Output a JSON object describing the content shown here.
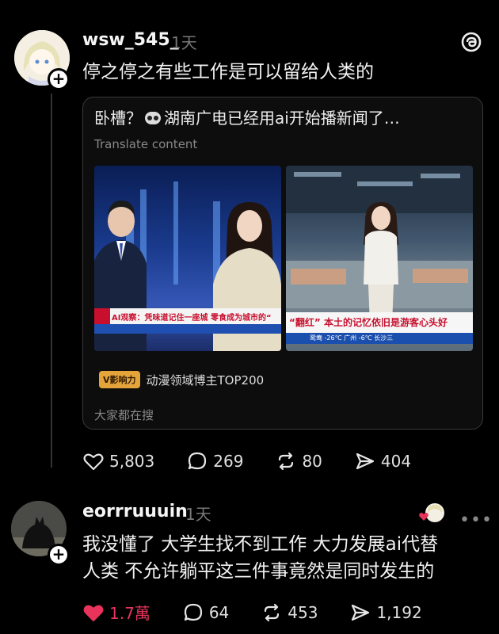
{
  "post": {
    "username": "wsw_545_",
    "time": "1天",
    "text": "停之停之有些工作是可以留给人类的",
    "card": {
      "title_prefix": "卧槽？",
      "title_suffix": "湖南广电已经用ai开始播新闻了…",
      "translate": "Translate content",
      "image1_caption": "AI观察：凭味道记住一座城 零食成为城市的“",
      "image2_caption": "“翻红” 本土的记忆依旧是游客心头好",
      "image2_ticker": "鸳鸯 -26℃  广州 -6℃  长沙三",
      "tag_badge": "V影响力",
      "tag_text": "动漫领域博主TOP200",
      "search_hint": "大家都在搜"
    },
    "stats": {
      "likes": "5,803",
      "comments": "269",
      "reposts": "80",
      "shares": "404"
    }
  },
  "reply": {
    "username": "eorrruuuin",
    "time": "1天",
    "text_line1": "我没懂了 大学生找不到工作 大力发展ai代替",
    "text_line2": "人类 不允许躺平这三件事竟然是同时发生的",
    "stats": {
      "likes": "1.7萬",
      "comments": "64",
      "reposts": "453",
      "shares": "1,192"
    }
  },
  "colors": {
    "background": "#000000",
    "liked": "#e8345a",
    "muted": "#777777"
  }
}
